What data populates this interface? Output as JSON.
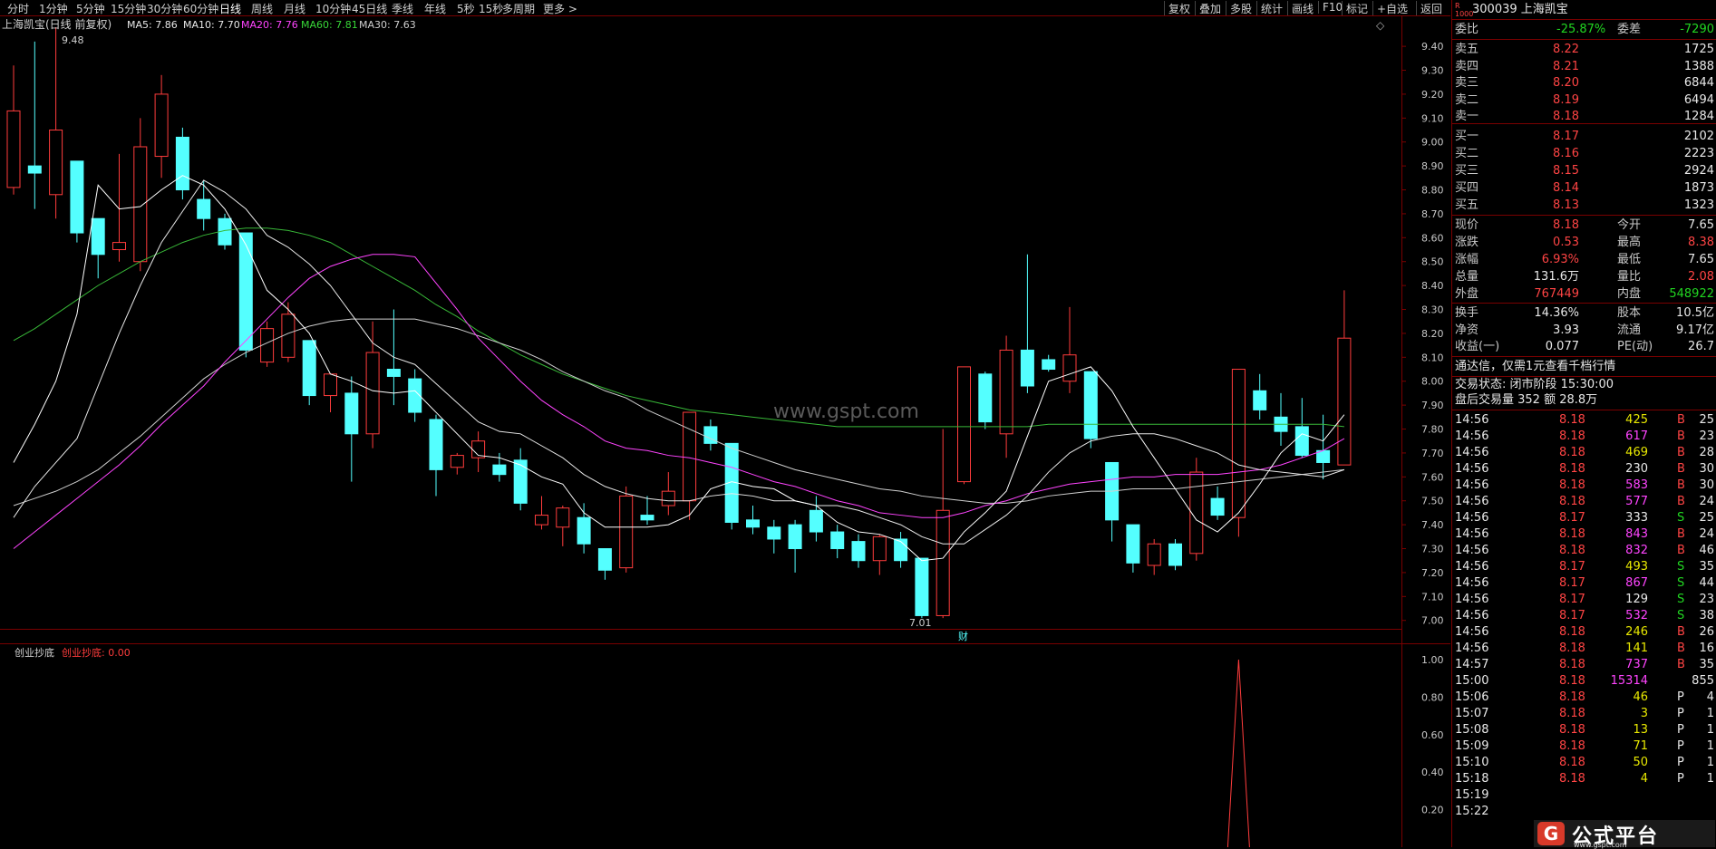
{
  "toolbar": {
    "periods": [
      "分时",
      "1分钟",
      "5分钟",
      "15分钟",
      "30分钟",
      "60分钟",
      "日线",
      "周线",
      "月线",
      "10分钟",
      "45日线",
      "季线",
      "年线",
      "5秒",
      "15秒",
      "多周期",
      "更多 >"
    ],
    "right_buttons": [
      "复权",
      "叠加",
      "多股",
      "统计",
      "画线",
      "F10",
      "标记",
      "+自选",
      "返回"
    ]
  },
  "chart_header": {
    "title": "上海凯宝(日线 前复权)",
    "ma5": "MA5: 7.86",
    "ma10": "MA10: 7.70",
    "ma20": "MA20: 7.76",
    "ma60": "MA60: 7.81",
    "ma30": "MA30: 7.63",
    "high_label": "9.48",
    "low_label": "7.01",
    "cai_label": "财",
    "watermark": "www.gspt.com"
  },
  "indicator": {
    "name": "创业抄底",
    "value_label": "创业抄底: 0.00",
    "axis": [
      "1.00",
      "0.80",
      "0.60",
      "0.40",
      "0.20"
    ]
  },
  "colors": {
    "up": "#ff3c3c",
    "down": "#54ffff",
    "ma5": "#ffffff",
    "ma10": "#e8e8e8",
    "ma20": "#ff44ff",
    "ma30": "#cfcfcf",
    "ma60": "#38b838"
  },
  "chart_data": {
    "type": "candlestick",
    "y_ticks": [
      "9.40",
      "9.30",
      "9.20",
      "9.10",
      "9.00",
      "8.90",
      "8.80",
      "8.70",
      "8.60",
      "8.50",
      "8.40",
      "8.30",
      "8.20",
      "8.10",
      "8.00",
      "7.90",
      "7.80",
      "7.70",
      "7.60",
      "7.50",
      "7.40",
      "7.30",
      "7.20",
      "7.10",
      "7.00"
    ],
    "ylim": [
      6.98,
      9.48
    ],
    "candles": [
      {
        "o": 8.81,
        "c": 9.13,
        "h": 9.32,
        "l": 8.78
      },
      {
        "o": 8.9,
        "c": 8.87,
        "h": 9.42,
        "l": 8.72
      },
      {
        "o": 8.78,
        "c": 9.05,
        "h": 9.48,
        "l": 8.68
      },
      {
        "o": 8.92,
        "c": 8.62,
        "h": 8.92,
        "l": 8.58
      },
      {
        "o": 8.68,
        "c": 8.53,
        "h": 8.68,
        "l": 8.43
      },
      {
        "o": 8.55,
        "c": 8.58,
        "h": 8.95,
        "l": 8.5
      },
      {
        "o": 8.5,
        "c": 8.98,
        "h": 9.1,
        "l": 8.46
      },
      {
        "o": 8.94,
        "c": 9.2,
        "h": 9.28,
        "l": 8.85
      },
      {
        "o": 9.02,
        "c": 8.8,
        "h": 9.06,
        "l": 8.76
      },
      {
        "o": 8.76,
        "c": 8.68,
        "h": 8.84,
        "l": 8.63
      },
      {
        "o": 8.68,
        "c": 8.57,
        "h": 8.7,
        "l": 8.55
      },
      {
        "o": 8.62,
        "c": 8.13,
        "h": 8.62,
        "l": 8.1
      },
      {
        "o": 8.08,
        "c": 8.22,
        "h": 8.25,
        "l": 8.06
      },
      {
        "o": 8.1,
        "c": 8.28,
        "h": 8.33,
        "l": 8.08
      },
      {
        "o": 8.17,
        "c": 7.94,
        "h": 8.17,
        "l": 7.9
      },
      {
        "o": 7.94,
        "c": 8.03,
        "h": 8.03,
        "l": 7.87
      },
      {
        "o": 7.95,
        "c": 7.78,
        "h": 8.02,
        "l": 7.58
      },
      {
        "o": 7.78,
        "c": 8.12,
        "h": 8.25,
        "l": 7.72
      },
      {
        "o": 8.05,
        "c": 8.02,
        "h": 8.3,
        "l": 7.9
      },
      {
        "o": 8.01,
        "c": 7.87,
        "h": 8.05,
        "l": 7.83
      },
      {
        "o": 7.84,
        "c": 7.63,
        "h": 7.86,
        "l": 7.52
      },
      {
        "o": 7.64,
        "c": 7.69,
        "h": 7.7,
        "l": 7.61
      },
      {
        "o": 7.68,
        "c": 7.75,
        "h": 7.79,
        "l": 7.62
      },
      {
        "o": 7.65,
        "c": 7.61,
        "h": 7.7,
        "l": 7.58
      },
      {
        "o": 7.67,
        "c": 7.49,
        "h": 7.72,
        "l": 7.46
      },
      {
        "o": 7.4,
        "c": 7.44,
        "h": 7.52,
        "l": 7.38
      },
      {
        "o": 7.39,
        "c": 7.47,
        "h": 7.48,
        "l": 7.31
      },
      {
        "o": 7.43,
        "c": 7.32,
        "h": 7.49,
        "l": 7.28
      },
      {
        "o": 7.3,
        "c": 7.21,
        "h": 7.3,
        "l": 7.17
      },
      {
        "o": 7.22,
        "c": 7.52,
        "h": 7.56,
        "l": 7.2
      },
      {
        "o": 7.44,
        "c": 7.42,
        "h": 7.52,
        "l": 7.4
      },
      {
        "o": 7.48,
        "c": 7.54,
        "h": 7.62,
        "l": 7.44
      },
      {
        "o": 7.5,
        "c": 7.87,
        "h": 7.87,
        "l": 7.42
      },
      {
        "o": 7.81,
        "c": 7.74,
        "h": 7.84,
        "l": 7.71
      },
      {
        "o": 7.74,
        "c": 7.41,
        "h": 7.74,
        "l": 7.38
      },
      {
        "o": 7.42,
        "c": 7.39,
        "h": 7.48,
        "l": 7.36
      },
      {
        "o": 7.39,
        "c": 7.34,
        "h": 7.42,
        "l": 7.28
      },
      {
        "o": 7.4,
        "c": 7.3,
        "h": 7.42,
        "l": 7.2
      },
      {
        "o": 7.46,
        "c": 7.37,
        "h": 7.52,
        "l": 7.33
      },
      {
        "o": 7.37,
        "c": 7.3,
        "h": 7.4,
        "l": 7.26
      },
      {
        "o": 7.33,
        "c": 7.25,
        "h": 7.36,
        "l": 7.22
      },
      {
        "o": 7.25,
        "c": 7.35,
        "h": 7.36,
        "l": 7.19
      },
      {
        "o": 7.34,
        "c": 7.25,
        "h": 7.37,
        "l": 7.22
      },
      {
        "o": 7.26,
        "c": 7.02,
        "h": 7.26,
        "l": 7.01
      },
      {
        "o": 7.02,
        "c": 7.46,
        "h": 7.8,
        "l": 7.01
      },
      {
        "o": 7.58,
        "c": 8.06,
        "h": 8.06,
        "l": 7.57
      },
      {
        "o": 8.03,
        "c": 7.83,
        "h": 8.04,
        "l": 7.8
      },
      {
        "o": 7.78,
        "c": 8.13,
        "h": 8.19,
        "l": 7.68
      },
      {
        "o": 8.13,
        "c": 7.98,
        "h": 8.53,
        "l": 7.95
      },
      {
        "o": 8.09,
        "c": 8.05,
        "h": 8.11,
        "l": 8.04
      },
      {
        "o": 8.0,
        "c": 8.11,
        "h": 8.31,
        "l": 7.95
      },
      {
        "o": 8.04,
        "c": 7.76,
        "h": 8.04,
        "l": 7.72
      },
      {
        "o": 7.66,
        "c": 7.42,
        "h": 7.66,
        "l": 7.33
      },
      {
        "o": 7.4,
        "c": 7.24,
        "h": 7.4,
        "l": 7.2
      },
      {
        "o": 7.23,
        "c": 7.32,
        "h": 7.34,
        "l": 7.19
      },
      {
        "o": 7.32,
        "c": 7.23,
        "h": 7.34,
        "l": 7.21
      },
      {
        "o": 7.28,
        "c": 7.62,
        "h": 7.68,
        "l": 7.25
      },
      {
        "o": 7.51,
        "c": 7.44,
        "h": 7.56,
        "l": 7.42
      },
      {
        "o": 7.43,
        "c": 8.05,
        "h": 8.05,
        "l": 7.35
      },
      {
        "o": 7.96,
        "c": 7.88,
        "h": 8.03,
        "l": 7.84
      },
      {
        "o": 7.85,
        "c": 7.79,
        "h": 7.95,
        "l": 7.73
      },
      {
        "o": 7.81,
        "c": 7.69,
        "h": 7.93,
        "l": 7.68
      },
      {
        "o": 7.71,
        "c": 7.66,
        "h": 7.86,
        "l": 7.59
      },
      {
        "o": 7.65,
        "c": 8.18,
        "h": 8.38,
        "l": 7.65
      }
    ],
    "ma5": [
      7.66,
      7.82,
      8.0,
      8.28,
      8.82,
      8.72,
      8.73,
      8.8,
      8.86,
      8.82,
      8.72,
      8.57,
      8.38,
      8.3,
      8.2,
      8.03,
      8.0,
      7.96,
      7.95,
      7.96,
      7.87,
      7.78,
      7.69,
      7.68,
      7.65,
      7.6,
      7.57,
      7.45,
      7.39,
      7.39,
      7.39,
      7.4,
      7.44,
      7.55,
      7.58,
      7.56,
      7.55,
      7.5,
      7.48,
      7.41,
      7.37,
      7.36,
      7.33,
      7.25,
      7.26,
      7.37,
      7.45,
      7.54,
      7.77,
      8.0,
      8.03,
      8.06,
      7.96,
      7.81,
      7.68,
      7.55,
      7.42,
      7.37,
      7.45,
      7.57,
      7.7,
      7.78,
      7.75,
      7.86
    ],
    "ma10": [
      7.43,
      7.56,
      7.66,
      7.76,
      7.98,
      8.2,
      8.4,
      8.58,
      8.71,
      8.84,
      8.79,
      8.72,
      8.61,
      8.56,
      8.49,
      8.4,
      8.28,
      8.16,
      8.1,
      8.07,
      7.99,
      7.91,
      7.83,
      7.79,
      7.78,
      7.73,
      7.68,
      7.61,
      7.56,
      7.53,
      7.51,
      7.5,
      7.5,
      7.52,
      7.53,
      7.52,
      7.5,
      7.5,
      7.48,
      7.48,
      7.46,
      7.43,
      7.4,
      7.35,
      7.32,
      7.32,
      7.38,
      7.44,
      7.52,
      7.62,
      7.7,
      7.75,
      7.77,
      7.78,
      7.78,
      7.76,
      7.73,
      7.7,
      7.65,
      7.63,
      7.62,
      7.61,
      7.6,
      7.63
    ],
    "ma20": [
      7.3,
      7.37,
      7.44,
      7.51,
      7.58,
      7.65,
      7.73,
      7.82,
      7.9,
      7.98,
      8.08,
      8.17,
      8.26,
      8.35,
      8.43,
      8.48,
      8.51,
      8.53,
      8.53,
      8.52,
      8.41,
      8.3,
      8.18,
      8.09,
      8.0,
      7.92,
      7.86,
      7.81,
      7.75,
      7.72,
      7.71,
      7.69,
      7.68,
      7.66,
      7.64,
      7.61,
      7.58,
      7.56,
      7.53,
      7.5,
      7.48,
      7.45,
      7.44,
      7.43,
      7.43,
      7.45,
      7.48,
      7.5,
      7.53,
      7.55,
      7.57,
      7.58,
      7.59,
      7.6,
      7.6,
      7.61,
      7.61,
      7.61,
      7.62,
      7.63,
      7.65,
      7.68,
      7.71,
      7.76
    ],
    "ma30": [
      7.48,
      7.51,
      7.54,
      7.58,
      7.63,
      7.7,
      7.77,
      7.85,
      7.93,
      8.01,
      8.07,
      8.12,
      8.16,
      8.2,
      8.23,
      8.25,
      8.26,
      8.26,
      8.26,
      8.26,
      8.24,
      8.22,
      8.19,
      8.16,
      8.13,
      8.09,
      8.04,
      8.0,
      7.96,
      7.93,
      7.88,
      7.84,
      7.8,
      7.76,
      7.72,
      7.69,
      7.66,
      7.63,
      7.61,
      7.59,
      7.57,
      7.55,
      7.54,
      7.52,
      7.51,
      7.5,
      7.49,
      7.49,
      7.5,
      7.52,
      7.53,
      7.54,
      7.54,
      7.55,
      7.55,
      7.55,
      7.56,
      7.57,
      7.58,
      7.59,
      7.6,
      7.61,
      7.62,
      7.63
    ],
    "ma60": [
      8.17,
      8.22,
      8.28,
      8.34,
      8.4,
      8.45,
      8.5,
      8.54,
      8.58,
      8.61,
      8.63,
      8.64,
      8.64,
      8.63,
      8.61,
      8.58,
      8.53,
      8.48,
      8.43,
      8.38,
      8.32,
      8.27,
      8.21,
      8.16,
      8.11,
      8.07,
      8.03,
      8.0,
      7.97,
      7.94,
      7.92,
      7.9,
      7.88,
      7.87,
      7.86,
      7.85,
      7.84,
      7.83,
      7.82,
      7.81,
      7.81,
      7.81,
      7.81,
      7.81,
      7.81,
      7.81,
      7.81,
      7.81,
      7.81,
      7.82,
      7.82,
      7.82,
      7.82,
      7.82,
      7.82,
      7.82,
      7.82,
      7.82,
      7.82,
      7.82,
      7.82,
      7.82,
      7.82,
      7.81
    ],
    "indicator_signal_index": 58
  },
  "quote": {
    "code_name": "300039 上海凯宝",
    "weibi_label": "委比",
    "weibi": "-25.87%",
    "weicha_label": "委差",
    "weicha": "-7290",
    "asks": [
      {
        "label": "卖五",
        "price": "8.22",
        "vol": "1725"
      },
      {
        "label": "卖四",
        "price": "8.21",
        "vol": "1388"
      },
      {
        "label": "卖三",
        "price": "8.20",
        "vol": "6844"
      },
      {
        "label": "卖二",
        "price": "8.19",
        "vol": "6494"
      },
      {
        "label": "卖一",
        "price": "8.18",
        "vol": "1284"
      }
    ],
    "bids": [
      {
        "label": "买一",
        "price": "8.17",
        "vol": "2102"
      },
      {
        "label": "买二",
        "price": "8.16",
        "vol": "2223"
      },
      {
        "label": "买三",
        "price": "8.15",
        "vol": "2924"
      },
      {
        "label": "买四",
        "price": "8.14",
        "vol": "1873"
      },
      {
        "label": "买五",
        "price": "8.13",
        "vol": "1323"
      }
    ],
    "stats": [
      {
        "l1": "现价",
        "v1": "8.18",
        "l2": "今开",
        "v2": "7.65",
        "c1": "red",
        "c2": "white"
      },
      {
        "l1": "涨跌",
        "v1": "0.53",
        "l2": "最高",
        "v2": "8.38",
        "c1": "red",
        "c2": "red"
      },
      {
        "l1": "涨幅",
        "v1": "6.93%",
        "l2": "最低",
        "v2": "7.65",
        "c1": "red",
        "c2": "white"
      },
      {
        "l1": "总量",
        "v1": "131.6万",
        "l2": "量比",
        "v2": "2.08",
        "c1": "white",
        "c2": "red"
      },
      {
        "l1": "外盘",
        "v1": "767449",
        "l2": "内盘",
        "v2": "548922",
        "c1": "red",
        "c2": "green"
      }
    ],
    "stats2": [
      {
        "l1": "换手",
        "v1": "14.36%",
        "l2": "股本",
        "v2": "10.5亿"
      },
      {
        "l1": "净资",
        "v1": "3.93",
        "l2": "流通",
        "v2": "9.17亿"
      },
      {
        "l1": "收益(一)",
        "v1": "0.077",
        "l2": "PE(动)",
        "v2": "26.7"
      }
    ],
    "notice": "通达信，仅需1元查看千档行情",
    "status": "交易状态: 闭市阶段 15:30:00",
    "after_hours": "盘后交易量 352 额 28.8万",
    "ticks": [
      {
        "t": "14:56",
        "p": "8.18",
        "v": "425",
        "bs": "B",
        "n": "25",
        "vc": "yellow"
      },
      {
        "t": "14:56",
        "p": "8.18",
        "v": "617",
        "bs": "B",
        "n": "23",
        "vc": "magenta"
      },
      {
        "t": "14:56",
        "p": "8.18",
        "v": "469",
        "bs": "B",
        "n": "28",
        "vc": "yellow"
      },
      {
        "t": "14:56",
        "p": "8.18",
        "v": "230",
        "bs": "B",
        "n": "30",
        "vc": "white"
      },
      {
        "t": "14:56",
        "p": "8.18",
        "v": "583",
        "bs": "B",
        "n": "30",
        "vc": "magenta"
      },
      {
        "t": "14:56",
        "p": "8.18",
        "v": "577",
        "bs": "B",
        "n": "24",
        "vc": "magenta"
      },
      {
        "t": "14:56",
        "p": "8.17",
        "v": "333",
        "bs": "S",
        "n": "25",
        "vc": "white"
      },
      {
        "t": "14:56",
        "p": "8.18",
        "v": "843",
        "bs": "B",
        "n": "24",
        "vc": "magenta"
      },
      {
        "t": "14:56",
        "p": "8.18",
        "v": "832",
        "bs": "B",
        "n": "46",
        "vc": "magenta"
      },
      {
        "t": "14:56",
        "p": "8.17",
        "v": "493",
        "bs": "S",
        "n": "35",
        "vc": "yellow"
      },
      {
        "t": "14:56",
        "p": "8.17",
        "v": "867",
        "bs": "S",
        "n": "44",
        "vc": "magenta"
      },
      {
        "t": "14:56",
        "p": "8.17",
        "v": "129",
        "bs": "S",
        "n": "23",
        "vc": "white"
      },
      {
        "t": "14:56",
        "p": "8.17",
        "v": "532",
        "bs": "S",
        "n": "38",
        "vc": "magenta"
      },
      {
        "t": "14:56",
        "p": "8.18",
        "v": "246",
        "bs": "B",
        "n": "26",
        "vc": "yellow"
      },
      {
        "t": "14:56",
        "p": "8.18",
        "v": "141",
        "bs": "B",
        "n": "16",
        "vc": "yellow"
      },
      {
        "t": "14:57",
        "p": "8.18",
        "v": "737",
        "bs": "B",
        "n": "35",
        "vc": "magenta"
      },
      {
        "t": "15:00",
        "p": "8.18",
        "v": "15314",
        "bs": "",
        "n": "855",
        "vc": "magenta"
      },
      {
        "t": "15:06",
        "p": "8.18",
        "v": "46",
        "bs": "P",
        "n": "4",
        "vc": "yellow"
      },
      {
        "t": "15:07",
        "p": "8.18",
        "v": "3",
        "bs": "P",
        "n": "1",
        "vc": "yellow"
      },
      {
        "t": "15:08",
        "p": "8.18",
        "v": "13",
        "bs": "P",
        "n": "1",
        "vc": "yellow"
      },
      {
        "t": "15:09",
        "p": "8.18",
        "v": "71",
        "bs": "P",
        "n": "1",
        "vc": "yellow"
      },
      {
        "t": "15:10",
        "p": "8.18",
        "v": "50",
        "bs": "P",
        "n": "1",
        "vc": "yellow"
      },
      {
        "t": "15:18",
        "p": "8.18",
        "v": "4",
        "bs": "P",
        "n": "1",
        "vc": "yellow"
      },
      {
        "t": "15:19",
        "p": "",
        "v": "",
        "bs": "",
        "n": "",
        "vc": "white"
      },
      {
        "t": "15:22",
        "p": "",
        "v": "",
        "bs": "",
        "n": "",
        "vc": "white"
      }
    ]
  },
  "logo": {
    "text": "公式平台",
    "url": "www.gspt.com",
    "mark": "G"
  }
}
